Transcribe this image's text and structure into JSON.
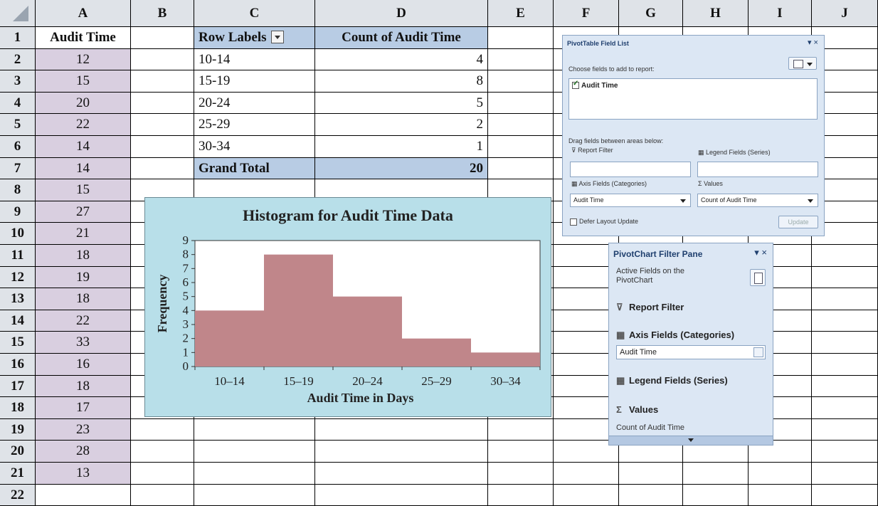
{
  "columns": [
    "A",
    "B",
    "C",
    "D",
    "E",
    "F",
    "G",
    "H",
    "I",
    "J"
  ],
  "rows": [
    "1",
    "2",
    "3",
    "4",
    "5",
    "6",
    "7",
    "8",
    "9",
    "10",
    "11",
    "12",
    "13",
    "14",
    "15",
    "16",
    "17",
    "18",
    "19",
    "20",
    "21",
    "22"
  ],
  "column_a": {
    "header": "Audit Time",
    "values": [
      "12",
      "15",
      "20",
      "22",
      "14",
      "14",
      "15",
      "27",
      "21",
      "18",
      "19",
      "18",
      "22",
      "33",
      "16",
      "18",
      "17",
      "23",
      "28",
      "13"
    ]
  },
  "pivot": {
    "row_labels": "Row Labels",
    "count_header": "Count of Audit Time",
    "rows": [
      {
        "label": "10-14",
        "count": "4"
      },
      {
        "label": "15-19",
        "count": "8"
      },
      {
        "label": "20-24",
        "count": "5"
      },
      {
        "label": "25-29",
        "count": "2"
      },
      {
        "label": "30-34",
        "count": "1"
      }
    ],
    "grand_total_label": "Grand Total",
    "grand_total_value": "20"
  },
  "chart_data": {
    "type": "bar",
    "title": "Histogram for Audit Time Data",
    "xlabel": "Audit Time in Days",
    "ylabel": "Frequency",
    "categories": [
      "10–14",
      "15–19",
      "20–24",
      "25–29",
      "30–34"
    ],
    "values": [
      4,
      8,
      5,
      2,
      1
    ],
    "ylim": [
      0,
      9
    ],
    "yticks": [
      "0",
      "1",
      "2",
      "3",
      "4",
      "5",
      "6",
      "7",
      "8",
      "9"
    ],
    "bar_color": "#c0868a",
    "plot_background": "#ffffff",
    "chart_background": "#b8dfe9",
    "grid": false
  },
  "field_list": {
    "title": "PivotTable Field List",
    "choose_label": "Choose fields to add to report:",
    "field": "Audit Time",
    "drag_label": "Drag fields between areas below:",
    "report_filter": "Report Filter",
    "legend_fields": "Legend Fields (Series)",
    "axis_fields": "Axis Fields (Categories)",
    "values": "Values",
    "axis_value": "Audit Time",
    "values_value": "Count of Audit Time",
    "defer_label": "Defer Layout Update",
    "update_button": "Update",
    "controls": "▾ ×"
  },
  "filter_pane": {
    "title": "PivotChart Filter Pane",
    "controls": "▾ ×",
    "active_fields": "Active Fields on the PivotChart",
    "report_filter": "Report Filter",
    "axis_fields": "Axis Fields (Categories)",
    "axis_value": "Audit Time",
    "legend_fields": "Legend Fields (Series)",
    "values": "Values",
    "values_value": "Count of Audit Time"
  },
  "colors": {
    "header_bg": "#dfe3e8",
    "column_a_bg": "#d9cfe0",
    "pivot_header_bg": "#b8cce4",
    "pane_bg": "#dce7f4"
  }
}
